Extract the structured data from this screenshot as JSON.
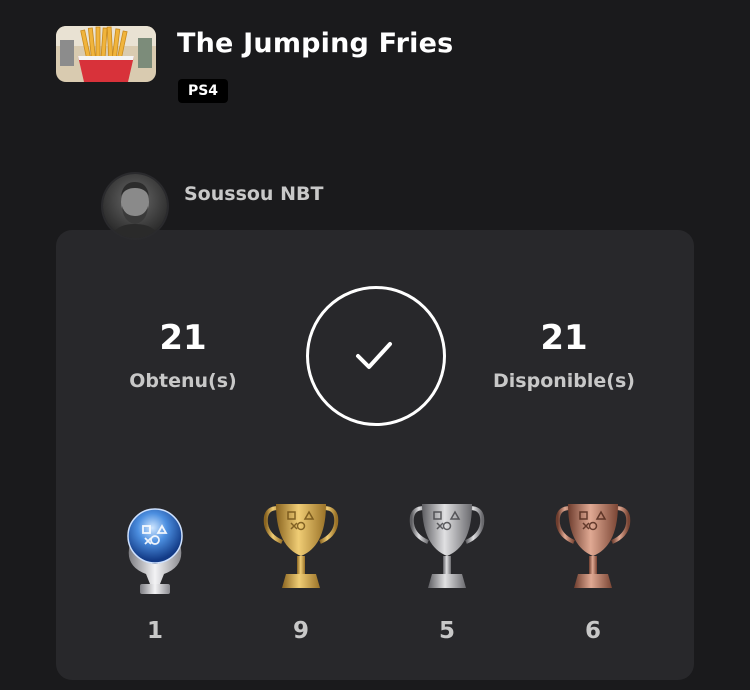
{
  "game": {
    "title": "The Jumping Fries",
    "platform": "PS4"
  },
  "user": {
    "name": "Soussou NBT"
  },
  "summary": {
    "earned": "21",
    "earned_label": "Obtenu(s)",
    "available": "21",
    "available_label": "Disponible(s)",
    "complete_icon": "checkmark-icon"
  },
  "trophies": [
    {
      "type": "platinum",
      "icon": "platinum-trophy-icon",
      "count": "1",
      "color": "#4c8fe0"
    },
    {
      "type": "gold",
      "icon": "gold-trophy-icon",
      "count": "9",
      "color": "#d4a84a"
    },
    {
      "type": "silver",
      "icon": "silver-trophy-icon",
      "count": "5",
      "color": "#a8a8a8"
    },
    {
      "type": "bronze",
      "icon": "bronze-trophy-icon",
      "count": "6",
      "color": "#b87a66"
    }
  ],
  "colors": {
    "background": "#1a1a1c",
    "card": "#28282b",
    "text_primary": "#ffffff",
    "text_secondary": "#c8c8c8"
  }
}
